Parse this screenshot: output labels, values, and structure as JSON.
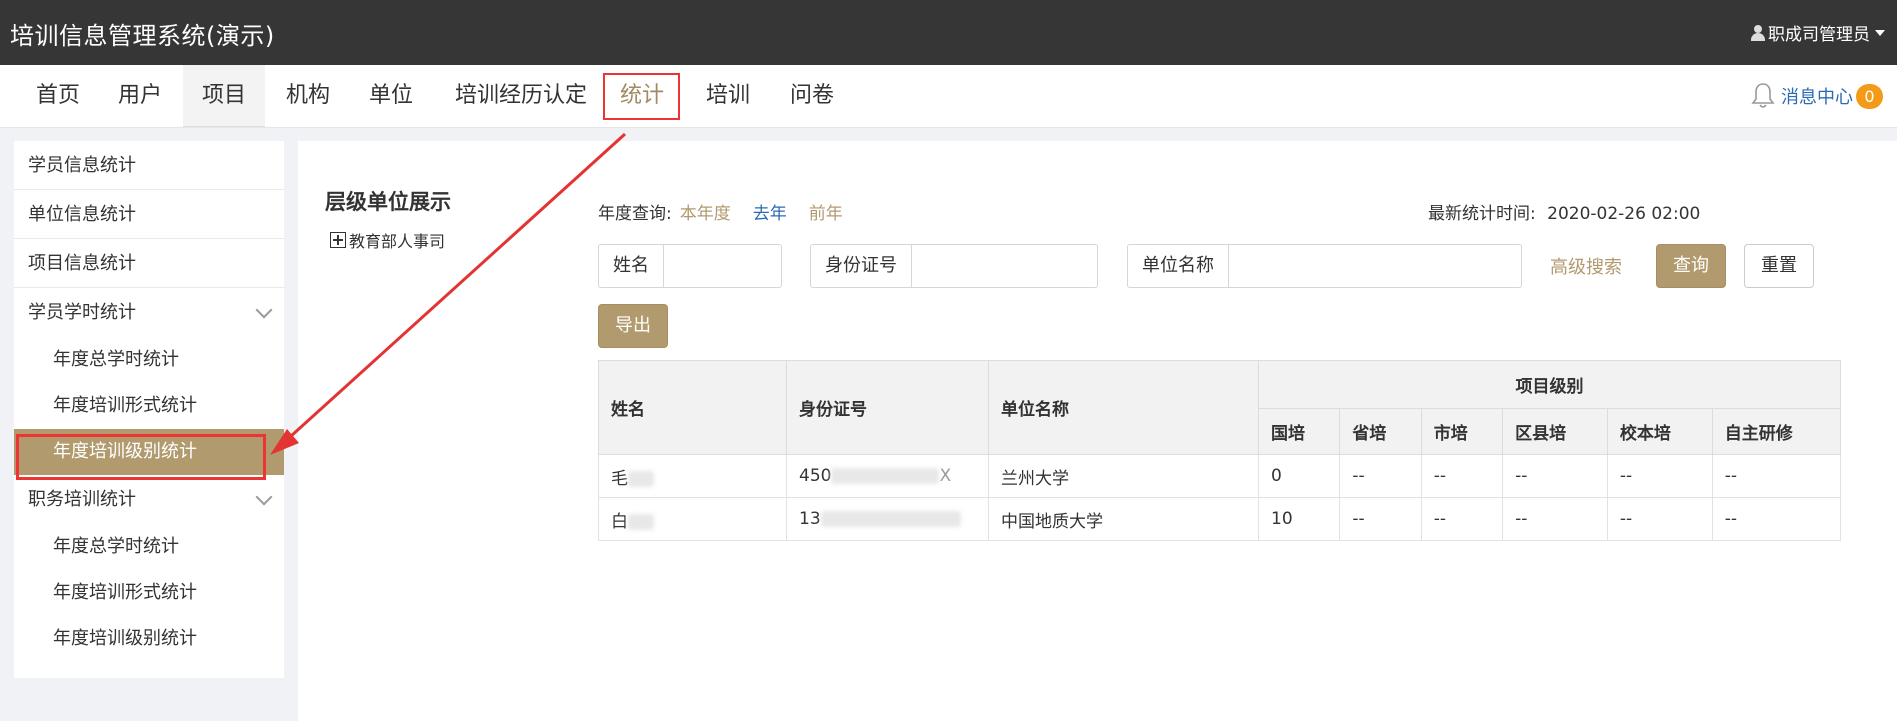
{
  "topbar": {
    "title": "培训信息管理系统(演示)",
    "user": "职成司管理员"
  },
  "nav": {
    "items": [
      "首页",
      "用户",
      "项目",
      "机构",
      "单位",
      "培训经历认定",
      "统计",
      "培训",
      "问卷"
    ],
    "message_center": "消息中心",
    "message_count": "0"
  },
  "sidebar": {
    "items": [
      {
        "label": "学员信息统计"
      },
      {
        "label": "单位信息统计"
      },
      {
        "label": "项目信息统计"
      },
      {
        "label": "学员学时统计"
      },
      {
        "label": "年度总学时统计"
      },
      {
        "label": "年度培训形式统计"
      },
      {
        "label": "年度培训级别统计"
      },
      {
        "label": "职务培训统计"
      },
      {
        "label": "年度总学时统计"
      },
      {
        "label": "年度培训形式统计"
      },
      {
        "label": "年度培训级别统计"
      }
    ]
  },
  "tree": {
    "title": "层级单位展示",
    "root": "教育部人事司"
  },
  "filters": {
    "year_label": "年度查询:",
    "year_this": "本年度",
    "year_last": "去年",
    "year_prev": "前年",
    "stat_time_label": "最新统计时间:",
    "stat_time": "2020-02-26 02:00",
    "name_label": "姓名",
    "id_label": "身份证号",
    "unit_label": "单位名称",
    "advanced": "高级搜索",
    "query": "查询",
    "reset": "重置",
    "export": "导出"
  },
  "table": {
    "headers": {
      "name": "姓名",
      "id": "身份证号",
      "unit": "单位名称",
      "level_group": "项目级别",
      "levels": [
        "国培",
        "省培",
        "市培",
        "区县培",
        "校本培",
        "自主研修"
      ]
    },
    "rows": [
      {
        "name": "毛",
        "id": "450",
        "id_tail": "X",
        "unit": "兰州大学",
        "levels": [
          "0",
          "--",
          "--",
          "--",
          "--",
          "--"
        ]
      },
      {
        "name": "白",
        "id": "13",
        "id_tail": "",
        "unit": "中国地质大学",
        "levels": [
          "10",
          "--",
          "--",
          "--",
          "--",
          "--"
        ]
      }
    ]
  },
  "colors": {
    "topbar": "#363636",
    "accent": "#b19a6d",
    "link": "#2c6bb4",
    "badge": "#f39a16",
    "highlight": "#e33333"
  }
}
